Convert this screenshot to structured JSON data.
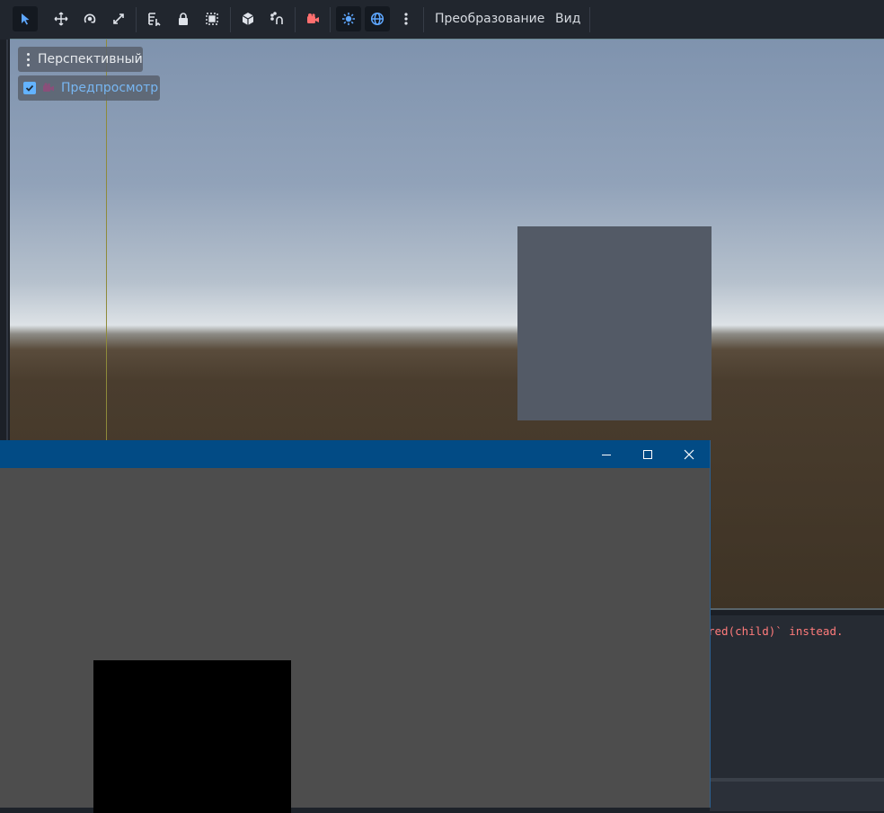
{
  "toolbar": {
    "tools": [
      {
        "name": "select-mode",
        "icon": "arrow-pointer-icon",
        "active": true
      },
      {
        "name": "move-mode",
        "icon": "move-arrows-icon"
      },
      {
        "name": "rotate-mode",
        "icon": "rotate-icon"
      },
      {
        "name": "scale-mode",
        "icon": "scale-icon"
      },
      {
        "name": "list-select",
        "icon": "list-select-icon"
      },
      {
        "name": "lock",
        "icon": "lock-icon"
      },
      {
        "name": "group",
        "icon": "group-icon"
      },
      {
        "name": "use-local-space",
        "icon": "cube-icon"
      },
      {
        "name": "snap",
        "icon": "snap-magnet-icon"
      },
      {
        "name": "camera",
        "icon": "camera-icon"
      },
      {
        "name": "preview-sun",
        "icon": "sun-icon",
        "active": true
      },
      {
        "name": "preview-environment",
        "icon": "globe-icon",
        "active": true
      },
      {
        "name": "more-options",
        "icon": "kebab-icon"
      }
    ],
    "menu_transform": "Преобразование",
    "menu_view": "Вид"
  },
  "viewport": {
    "perspective_label": "Перспективный",
    "preview_label": "Предпросмотр",
    "preview_checked": true
  },
  "console": {
    "line": "red(child)` instead."
  },
  "game_window": {
    "title": "",
    "controls": [
      "minimize-icon",
      "maximize-icon",
      "close-icon"
    ]
  },
  "colors": {
    "accent": "#63b3ff",
    "titlebar": "#024b85",
    "error_text": "#ff7b7b",
    "camera_icon": "#ff6f6f"
  }
}
